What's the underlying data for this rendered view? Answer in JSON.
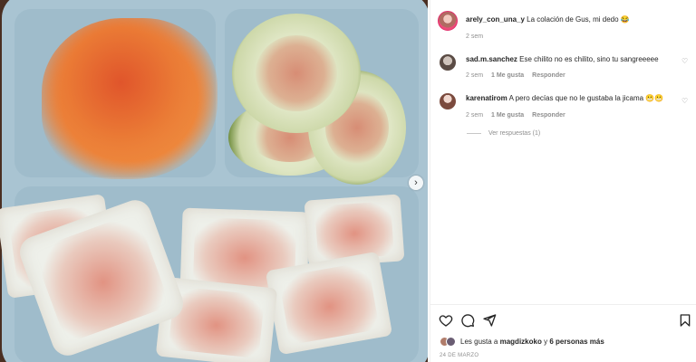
{
  "post": {
    "author": "arely_con_una_y",
    "caption": "La colación de Gus, mi dedo",
    "caption_emoji": "😂",
    "time": "2 sem"
  },
  "comments": [
    {
      "username": "sad.m.sanchez",
      "text": "Ese chilito no es chilito, sino tu sangreeeee",
      "time": "2 sem",
      "likes": "1 Me gusta",
      "reply": "Responder"
    },
    {
      "username": "karenatirom",
      "text": "A pero decías que no le gustaba la jicama",
      "emoji": "😬😬",
      "time": "2 sem",
      "likes": "1 Me gusta",
      "reply": "Responder"
    }
  ],
  "view_replies": "Ver respuestas (1)",
  "likes": {
    "prefix": "Les gusta a",
    "user": "magdizkoko",
    "middle": "y",
    "others": "6 personas más"
  },
  "date": "24 DE MARZO",
  "icons": {
    "like": "heart-icon",
    "comment": "comment-icon",
    "share": "send-icon",
    "save": "bookmark-icon",
    "next": "chevron-right-icon"
  },
  "colors": {
    "text": "#262626",
    "muted": "#8e8e8e",
    "story_ring": "#e1306c"
  }
}
